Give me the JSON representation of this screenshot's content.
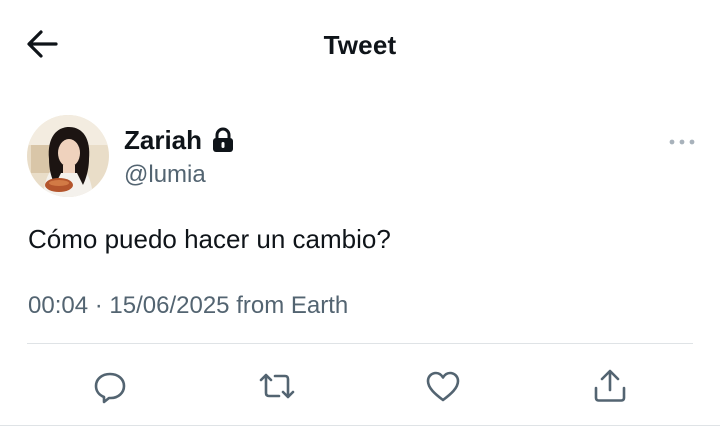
{
  "header": {
    "title": "Tweet",
    "back_icon": "arrow-left-icon"
  },
  "tweet": {
    "author": {
      "display_name": "Zariah",
      "handle": "@lumia",
      "protected_icon": "lock-icon",
      "avatar": "profile-photo"
    },
    "more_icon": "more-horizontal-icon",
    "text": "Cómo puedo hacer un cambio?",
    "meta": {
      "time": "00:04",
      "separator": "·",
      "date": "15/06/2025",
      "source": "from Earth"
    }
  },
  "actions": [
    {
      "icon": "reply-icon"
    },
    {
      "icon": "retweet-icon"
    },
    {
      "icon": "like-icon"
    },
    {
      "icon": "share-icon"
    }
  ],
  "colors": {
    "text_primary": "#0f1419",
    "text_secondary": "#536471",
    "divider": "#dfe3e6",
    "icon": "#536471"
  }
}
